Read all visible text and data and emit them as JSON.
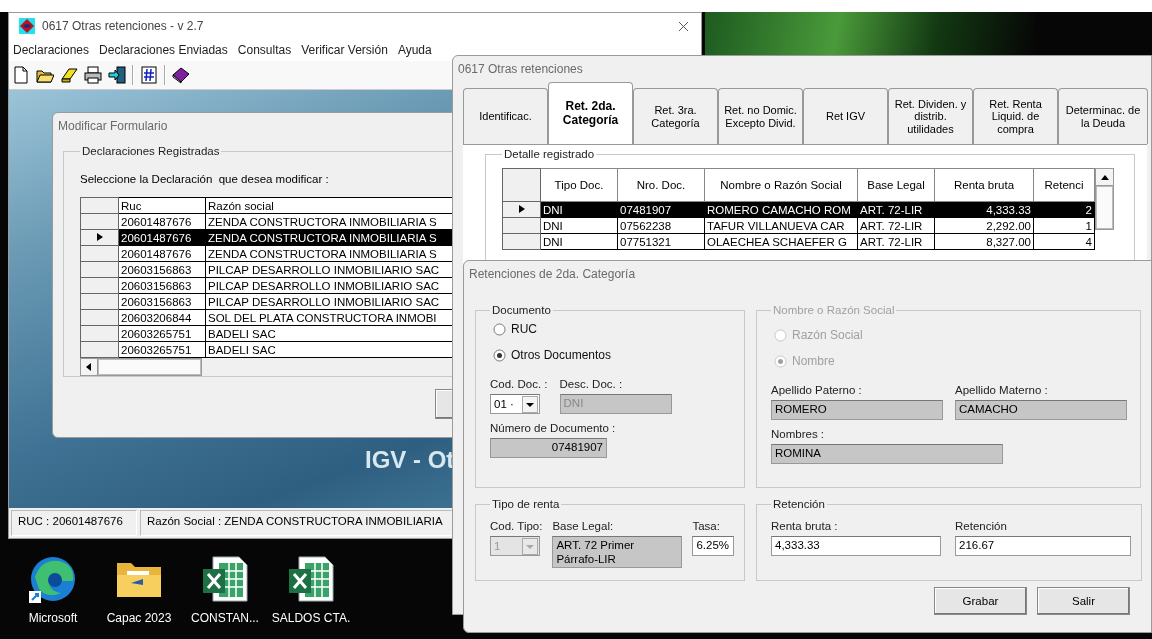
{
  "desktop_icons": [
    {
      "label": "Microsoft",
      "kind": "browser"
    },
    {
      "label": "Capac 2023",
      "kind": "folder"
    },
    {
      "label": "CONSTAN...",
      "kind": "spreadsheet"
    },
    {
      "label": "SALDOS CTA.",
      "kind": "spreadsheet"
    }
  ],
  "main_window": {
    "title": "0617 Otras retenciones - v 2.7",
    "menu": [
      "Declaraciones",
      "Declaraciones Enviadas",
      "Consultas",
      "Verificar Versión",
      "Ayuda"
    ],
    "banner": "IGV - Ot",
    "status_bar": [
      "RUC : 20601487676",
      "Razón Social : ZENDA CONSTRUCTORA INMOBILIARIA"
    ]
  },
  "modify_dialog": {
    "title": "Modificar Formulario",
    "group": "Declaraciones Registradas",
    "prompt": "Seleccione la Declaración  que desea modificar :",
    "columns": [
      "Ruc",
      "Razón social"
    ],
    "rows": [
      {
        "cells": [
          "20601487676",
          "ZENDA CONSTRUCTORA INMOBILIARIA S"
        ],
        "selected": false
      },
      {
        "cells": [
          "20601487676",
          "ZENDA CONSTRUCTORA INMOBILIARIA S"
        ],
        "selected": true
      },
      {
        "cells": [
          "20601487676",
          "ZENDA CONSTRUCTORA INMOBILIARIA S"
        ],
        "selected": false
      },
      {
        "cells": [
          "20603156863",
          "PILCAP DESARROLLO INMOBILIARIO SAC"
        ],
        "selected": false
      },
      {
        "cells": [
          "20603156863",
          "PILCAP DESARROLLO INMOBILIARIO SAC"
        ],
        "selected": false
      },
      {
        "cells": [
          "20603156863",
          "PILCAP DESARROLLO INMOBILIARIO SAC"
        ],
        "selected": false
      },
      {
        "cells": [
          "20603206844",
          "SOL DEL PLATA CONSTRUCTORA INMOBI"
        ],
        "selected": false
      },
      {
        "cells": [
          "20603265751",
          "BADELI SAC"
        ],
        "selected": false
      },
      {
        "cells": [
          "20603265751",
          "BADELI SAC"
        ],
        "selected": false
      }
    ]
  },
  "form_window": {
    "title": "0617 Otras retenciones",
    "tabs": [
      {
        "label": "Identificac.",
        "selected": false
      },
      {
        "label": "Ret. 2da.\nCategoría",
        "selected": true
      },
      {
        "label": "Ret. 3ra.\nCategoría",
        "selected": false
      },
      {
        "label": "Ret. no Domic.\nExcepto Divid.",
        "selected": false
      },
      {
        "label": "Ret IGV",
        "selected": false
      },
      {
        "label": "Ret. Dividen. y\ndistrib.\nutilidades",
        "selected": false
      },
      {
        "label": "Ret. Renta\nLiquid. de\ncompra",
        "selected": false
      },
      {
        "label": "Determinac. de\nla Deuda",
        "selected": false
      }
    ],
    "group": "Detalle registrado",
    "columns": [
      "Tipo Doc.",
      "Nro. Doc.",
      "Nombre o Razón Social",
      "Base Legal",
      "Renta bruta",
      "Retenci"
    ],
    "rows": [
      {
        "cells": [
          "DNI",
          "07481907",
          "ROMERO CAMACHO ROM",
          "ART. 72-LIR",
          "4,333.33",
          "2"
        ],
        "selected": true
      },
      {
        "cells": [
          "DNI",
          "07562238",
          "TAFUR VILLANUEVA CAR",
          "ART. 72-LIR",
          "2,292.00",
          "1"
        ],
        "selected": false
      },
      {
        "cells": [
          "DNI",
          "07751321",
          "OLAECHEA SCHAEFER G",
          "ART. 72-LIR",
          "8,327.00",
          "4"
        ],
        "selected": false
      }
    ]
  },
  "detail_dialog": {
    "title": "Retenciones de 2da. Categoría",
    "groups": [
      {
        "kind": "document",
        "legend": "Documento",
        "disabled": false,
        "rows": [
          [
            {
              "kind": "radio",
              "label": "RUC",
              "selected": false
            }
          ],
          [
            {
              "kind": "radio",
              "label": "Otros Documentos",
              "selected": true
            }
          ],
          [
            {
              "kind": "combo",
              "label": "Cod. Doc. :",
              "value": "01 ·",
              "disabled": false,
              "readonly": false
            },
            {
              "kind": "text",
              "label": "Desc. Doc. :",
              "value": "DNI",
              "disabled": true,
              "readonly": true
            }
          ],
          [
            {
              "kind": "text",
              "label": "Número de Documento :",
              "value": "07481907",
              "disabled": false,
              "readonly": true
            }
          ]
        ]
      },
      {
        "kind": "name",
        "legend": "Nombre o Razón Social",
        "disabled": true,
        "rows": [
          [
            {
              "kind": "radio",
              "label": "Razón Social",
              "selected": false
            }
          ],
          [
            {
              "kind": "radio",
              "label": "Nombre",
              "selected": true
            }
          ],
          [
            {
              "kind": "text",
              "label": "Apellido Paterno :",
              "value": "ROMERO",
              "disabled": false,
              "readonly": true
            },
            {
              "kind": "text",
              "label": "Apellido Materno :",
              "value": "CAMACHO",
              "disabled": false,
              "readonly": true
            }
          ],
          [
            {
              "kind": "text",
              "label": "Nombres :",
              "value": "ROMINA",
              "disabled": false,
              "readonly": true
            }
          ]
        ]
      },
      {
        "kind": "income",
        "legend": "Tipo de renta",
        "disabled": false,
        "rows": [
          [
            {
              "kind": "combo",
              "label": "Cod. Tipo:",
              "value": "1",
              "disabled": true,
              "readonly": false
            },
            {
              "kind": "memo",
              "label": "Base Legal:",
              "value": "ART. 72 Primer\nPárrafo-LIR",
              "disabled": false,
              "readonly": true
            },
            {
              "kind": "text",
              "label": "Tasa:",
              "value": "6.25%",
              "disabled": false,
              "readonly": false
            }
          ]
        ]
      },
      {
        "kind": "retention",
        "legend": "Retención",
        "disabled": false,
        "rows": [
          [
            {
              "kind": "text",
              "label": "Renta bruta :",
              "value": "4,333.33",
              "disabled": false,
              "readonly": false
            },
            {
              "kind": "text",
              "label": "Retención",
              "value": "216.67",
              "disabled": false,
              "readonly": false
            }
          ]
        ]
      }
    ],
    "buttons": [
      "Grabar",
      "Salir"
    ]
  }
}
